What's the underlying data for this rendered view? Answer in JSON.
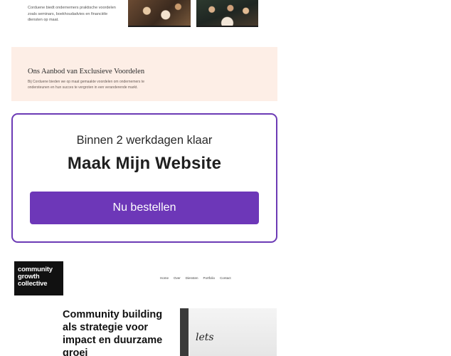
{
  "top_preview": {
    "intro_text": "Corduene biedt ondernemers praktische voordelen zoals seminars, boekhoudadvies en financiële diensten op maat.",
    "offer_title": "Ons Aanbod van Exclusieve Voordelen",
    "offer_text": "Bij Corduene bieden we op maat gemaakte voordelen om ondernemers te ondersteunen en hun succes te vergroten in een veranderende markt."
  },
  "cta": {
    "subtitle": "Binnen 2 werkdagen klaar",
    "title": "Maak Mijn Website",
    "button_label": "Nu bestellen"
  },
  "bottom_preview": {
    "logo_lines": [
      "community",
      "growth",
      "collective"
    ],
    "nav": [
      "Home",
      "Over",
      "Diensten",
      "Portfolio",
      "Contact"
    ],
    "hero_title": "Community building als strategie voor impact en duurzame groei",
    "photo_scribble": "lets"
  },
  "colors": {
    "accent": "#6d37b8",
    "offer_band": "#fdeee6",
    "logo_bg": "#111111"
  }
}
